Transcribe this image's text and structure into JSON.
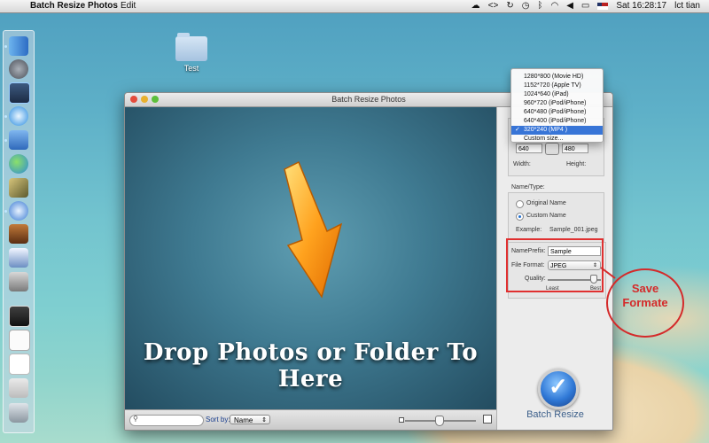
{
  "menubar": {
    "app_name": "Batch Resize Photos",
    "menu_edit": "Edit",
    "clock": "Sat 16:28:17",
    "user": "lct tian"
  },
  "desktop": {
    "folder_label": "Test"
  },
  "window": {
    "title": "Batch Resize Photos",
    "drop_text": "Drop Photos or Folder To Here",
    "sort_label": "Sort by:",
    "sort_value": "Name"
  },
  "size_menu": {
    "options": [
      "1280*800 (Movie HD)",
      "1152*720 (Apple TV)",
      "1024*640 (iPad)",
      "960*720 (iPod/iPhone)",
      "640*480 (iPod/iPhone)",
      "640*400 (iPod/iPhone)",
      "320*240 (MP4 )",
      "Custom size..."
    ],
    "selected_index": 6,
    "check": "✓"
  },
  "size": {
    "width_value": "640",
    "height_value": "480",
    "width_label": "Width:",
    "height_label": "Height:"
  },
  "naming": {
    "section_label": "Name/Type:",
    "original_name": "Original Name",
    "custom_name": "Custom Name",
    "example_label": "Example:",
    "example_value": "Sample_001.jpeg",
    "prefix_label": "NamePrefix:",
    "prefix_value": "Sample",
    "format_label": "File Format:",
    "format_value": "JPEG",
    "quality_label": "Quality:",
    "quality_least": "Least",
    "quality_best": "Best",
    "quality_level": 0.85
  },
  "action": {
    "batch_label": "Batch Resize"
  },
  "callout": {
    "line1": "Save",
    "line2": "Formate"
  },
  "colors": {
    "highlight": "#e03030",
    "selection": "#3875d7",
    "accent": "#3c5f8a"
  }
}
